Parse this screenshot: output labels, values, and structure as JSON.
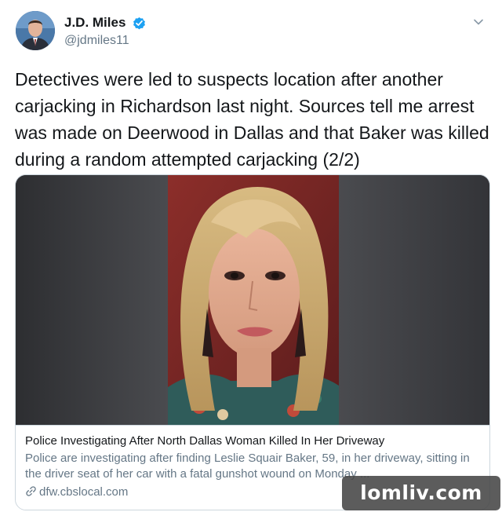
{
  "author": {
    "display_name": "J.D. Miles",
    "handle": "@jdmiles11",
    "verified": true
  },
  "icons": {
    "verified": "verified-badge-icon",
    "caret": "chevron-down-icon",
    "link": "link-icon"
  },
  "tweet": {
    "text": "Detectives were led to suspects location after another carjacking in Richardson last night. Sources tell me arrest was made on Deerwood in Dallas and that Baker was killed during a random attempted carjacking (2/2)"
  },
  "card": {
    "title": "Police Investigating After North Dallas Woman Killed In Her Driveway",
    "description": "Police are investigating after finding Leslie Squair Baker, 59, in her driveway, sitting in the driver seat of her car with a fatal gunshot wound on Monday ...",
    "domain": "dfw.cbslocal.com"
  },
  "watermark": {
    "text": "lomliv.com"
  },
  "colors": {
    "text_primary": "#14171a",
    "text_secondary": "#657786",
    "verified_blue": "#1da1f2",
    "border": "#ccd6dd"
  }
}
